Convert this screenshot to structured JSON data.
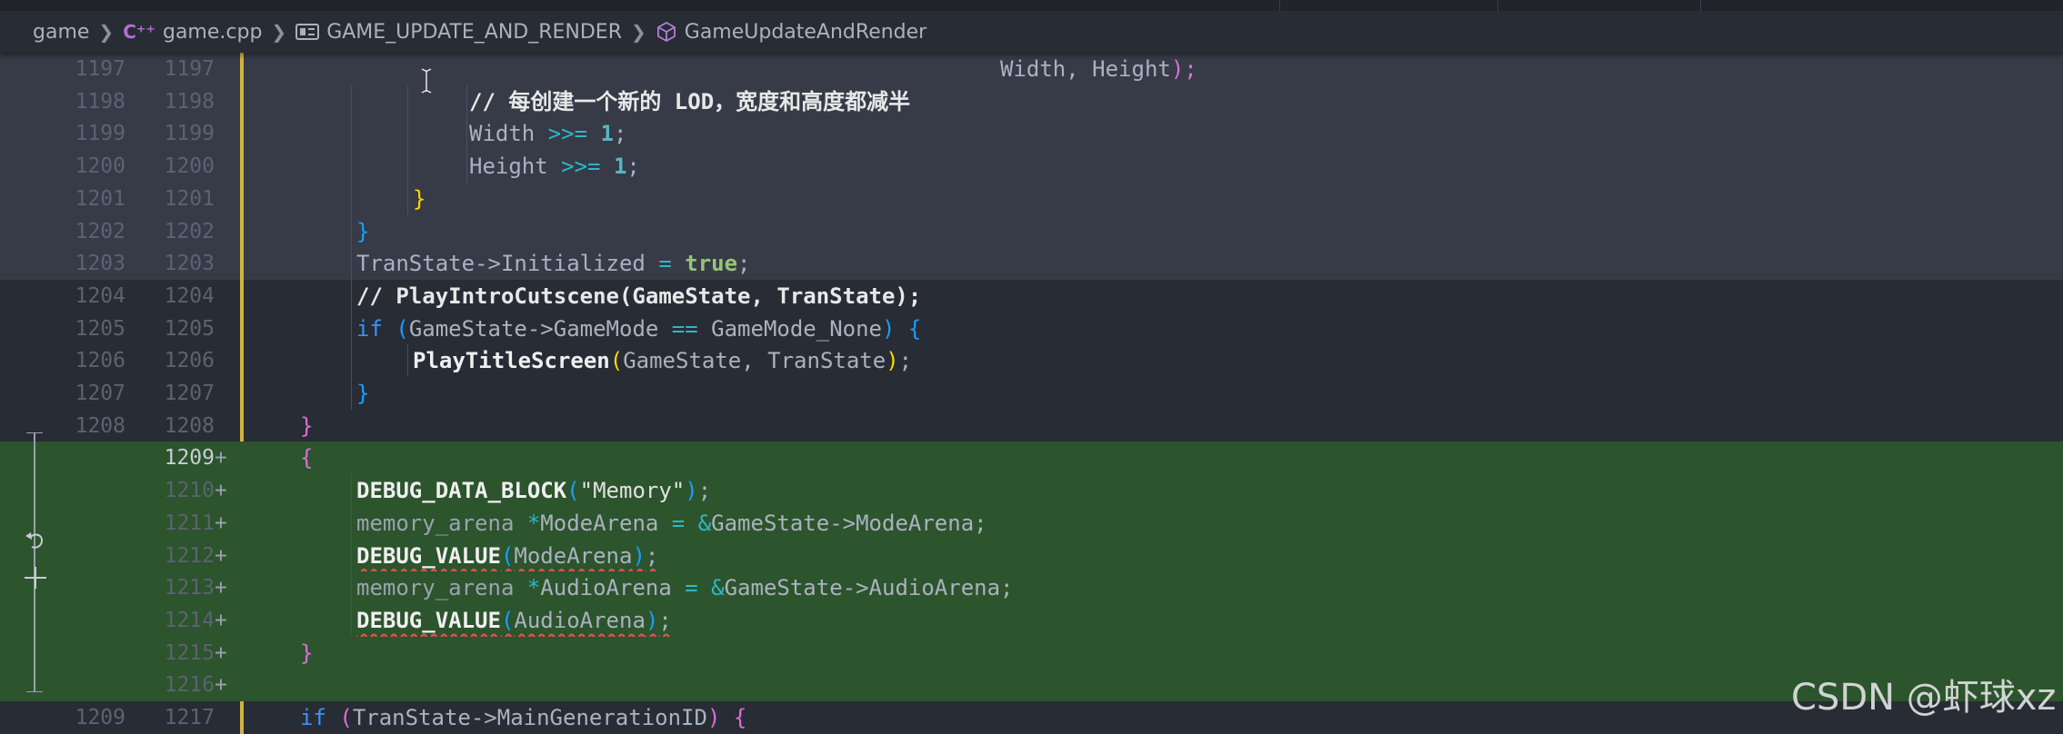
{
  "breadcrumb": {
    "folder": "game",
    "file": "game.cpp",
    "enum_symbol": "GAME_UPDATE_AND_RENDER",
    "function_symbol": "GameUpdateAndRender"
  },
  "colors": {
    "added_background": "#2c542d",
    "modified_gutter": "#d2b23f",
    "editor_background": "#282c34"
  },
  "icons": {
    "cpp_file": "cpp-file-icon",
    "enum": "enum-icon",
    "function": "cube-icon",
    "revert": "revert-icon",
    "stage": "plus-icon",
    "cursor": "text-cursor-icon"
  },
  "watermark": "CSDN @虾球xz",
  "lines": [
    {
      "orig": "1197",
      "mod": "1197",
      "added": false,
      "sticky": true,
      "indent": 0,
      "tokens": [
        {
          "t": "Width, Height",
          "c": "t-plain"
        },
        {
          "t": ");",
          "c": "b2"
        }
      ]
    },
    {
      "orig": "1198",
      "mod": "1198",
      "added": false,
      "sticky": true,
      "indent": 4,
      "tokens": [
        {
          "t": "// 每创建一个新的 LOD，宽度和高度都减半",
          "c": "t-comment"
        }
      ]
    },
    {
      "orig": "1199",
      "mod": "1199",
      "added": false,
      "sticky": true,
      "indent": 4,
      "tokens": [
        {
          "t": "Width ",
          "c": "t-var"
        },
        {
          "t": ">>=",
          "c": "t-op"
        },
        {
          "t": " ",
          "c": "t-plain"
        },
        {
          "t": "1",
          "c": "t-num"
        },
        {
          "t": ";",
          "c": "t-plain"
        }
      ]
    },
    {
      "orig": "1200",
      "mod": "1200",
      "added": false,
      "sticky": true,
      "indent": 4,
      "tokens": [
        {
          "t": "Height ",
          "c": "t-var"
        },
        {
          "t": ">>=",
          "c": "t-op"
        },
        {
          "t": " ",
          "c": "t-plain"
        },
        {
          "t": "1",
          "c": "t-num"
        },
        {
          "t": ";",
          "c": "t-plain"
        }
      ]
    },
    {
      "orig": "1201",
      "mod": "1201",
      "added": false,
      "sticky": true,
      "indent": 3,
      "tokens": [
        {
          "t": "}",
          "c": "b1"
        }
      ]
    },
    {
      "orig": "1202",
      "mod": "1202",
      "added": false,
      "sticky": true,
      "indent": 2,
      "tokens": [
        {
          "t": "}",
          "c": "b3"
        }
      ]
    },
    {
      "orig": "1203",
      "mod": "1203",
      "added": false,
      "sticky": true,
      "indent": 2,
      "tokens": [
        {
          "t": "TranState->Initialized ",
          "c": "t-var"
        },
        {
          "t": "=",
          "c": "t-op"
        },
        {
          "t": " ",
          "c": "t-plain"
        },
        {
          "t": "true",
          "c": "t-bool"
        },
        {
          "t": ";",
          "c": "t-plain"
        }
      ]
    },
    {
      "orig": "1204",
      "mod": "1204",
      "added": false,
      "sticky": false,
      "indent": 2,
      "tokens": [
        {
          "t": "// PlayIntroCutscene(GameState, TranState);",
          "c": "t-comment"
        }
      ]
    },
    {
      "orig": "1205",
      "mod": "1205",
      "added": false,
      "sticky": false,
      "indent": 2,
      "tokens": [
        {
          "t": "if",
          "c": "t-kw"
        },
        {
          "t": " ",
          "c": "t-plain"
        },
        {
          "t": "(",
          "c": "b3"
        },
        {
          "t": "GameState->GameMode ",
          "c": "t-var"
        },
        {
          "t": "==",
          "c": "t-op"
        },
        {
          "t": " GameMode_None",
          "c": "t-var"
        },
        {
          "t": ")",
          "c": "b3"
        },
        {
          "t": " ",
          "c": "t-plain"
        },
        {
          "t": "{",
          "c": "b3"
        }
      ]
    },
    {
      "orig": "1206",
      "mod": "1206",
      "added": false,
      "sticky": false,
      "indent": 3,
      "tokens": [
        {
          "t": "PlayTitleScreen",
          "c": "t-fn"
        },
        {
          "t": "(",
          "c": "b1"
        },
        {
          "t": "GameState, TranState",
          "c": "t-var"
        },
        {
          "t": ")",
          "c": "b1"
        },
        {
          "t": ";",
          "c": "t-plain"
        }
      ]
    },
    {
      "orig": "1207",
      "mod": "1207",
      "added": false,
      "sticky": false,
      "indent": 2,
      "tokens": [
        {
          "t": "}",
          "c": "b3"
        }
      ]
    },
    {
      "orig": "1208",
      "mod": "1208",
      "added": false,
      "sticky": false,
      "indent": 1,
      "tokens": [
        {
          "t": "}",
          "c": "b2"
        }
      ]
    },
    {
      "orig": "",
      "mod": "1209",
      "added": true,
      "active": true,
      "indent": 1,
      "tokens": [
        {
          "t": "{",
          "c": "b2"
        }
      ]
    },
    {
      "orig": "",
      "mod": "1210",
      "added": true,
      "indent": 2,
      "tokens": [
        {
          "t": "DEBUG_DATA_BLOCK",
          "c": "t-fn"
        },
        {
          "t": "(",
          "c": "b3"
        },
        {
          "t": "\"Memory\"",
          "c": "t-str"
        },
        {
          "t": ")",
          "c": "b3"
        },
        {
          "t": ";",
          "c": "t-plain"
        }
      ]
    },
    {
      "orig": "",
      "mod": "1211",
      "added": true,
      "indent": 2,
      "tokens": [
        {
          "t": "memory_arena ",
          "c": "t-type"
        },
        {
          "t": "*",
          "c": "t-op"
        },
        {
          "t": "ModeArena ",
          "c": "t-var"
        },
        {
          "t": "=",
          "c": "t-op"
        },
        {
          "t": " ",
          "c": "t-plain"
        },
        {
          "t": "&",
          "c": "t-op"
        },
        {
          "t": "GameState->ModeArena;",
          "c": "t-var"
        }
      ]
    },
    {
      "orig": "",
      "mod": "1212",
      "added": true,
      "indent": 2,
      "squiggle": true,
      "tokens": [
        {
          "t": "DEBUG_VALUE",
          "c": "t-fn"
        },
        {
          "t": "(",
          "c": "b3"
        },
        {
          "t": "ModeArena",
          "c": "t-var"
        },
        {
          "t": ")",
          "c": "b3"
        },
        {
          "t": ";",
          "c": "t-plain"
        }
      ]
    },
    {
      "orig": "",
      "mod": "1213",
      "added": true,
      "indent": 2,
      "tokens": [
        {
          "t": "memory_arena ",
          "c": "t-type"
        },
        {
          "t": "*",
          "c": "t-op"
        },
        {
          "t": "AudioArena ",
          "c": "t-var"
        },
        {
          "t": "=",
          "c": "t-op"
        },
        {
          "t": " ",
          "c": "t-plain"
        },
        {
          "t": "&",
          "c": "t-op"
        },
        {
          "t": "GameState->AudioArena;",
          "c": "t-var"
        }
      ]
    },
    {
      "orig": "",
      "mod": "1214",
      "added": true,
      "indent": 2,
      "squiggle": true,
      "tokens": [
        {
          "t": "DEBUG_VALUE",
          "c": "t-fn"
        },
        {
          "t": "(",
          "c": "b3"
        },
        {
          "t": "AudioArena",
          "c": "t-var"
        },
        {
          "t": ")",
          "c": "b3"
        },
        {
          "t": ";",
          "c": "t-plain"
        }
      ]
    },
    {
      "orig": "",
      "mod": "1215",
      "added": true,
      "indent": 1,
      "tokens": [
        {
          "t": "}",
          "c": "b2"
        }
      ]
    },
    {
      "orig": "",
      "mod": "1216",
      "added": true,
      "indent": 0,
      "tokens": []
    },
    {
      "orig": "1209",
      "mod": "1217",
      "added": false,
      "indent": 1,
      "tokens": [
        {
          "t": "if",
          "c": "t-kw"
        },
        {
          "t": " ",
          "c": "t-plain"
        },
        {
          "t": "(",
          "c": "b2"
        },
        {
          "t": "TranState->MainGenerationID",
          "c": "t-var"
        },
        {
          "t": ")",
          "c": "b2"
        },
        {
          "t": " ",
          "c": "t-plain"
        },
        {
          "t": "{",
          "c": "b2"
        }
      ]
    }
  ]
}
